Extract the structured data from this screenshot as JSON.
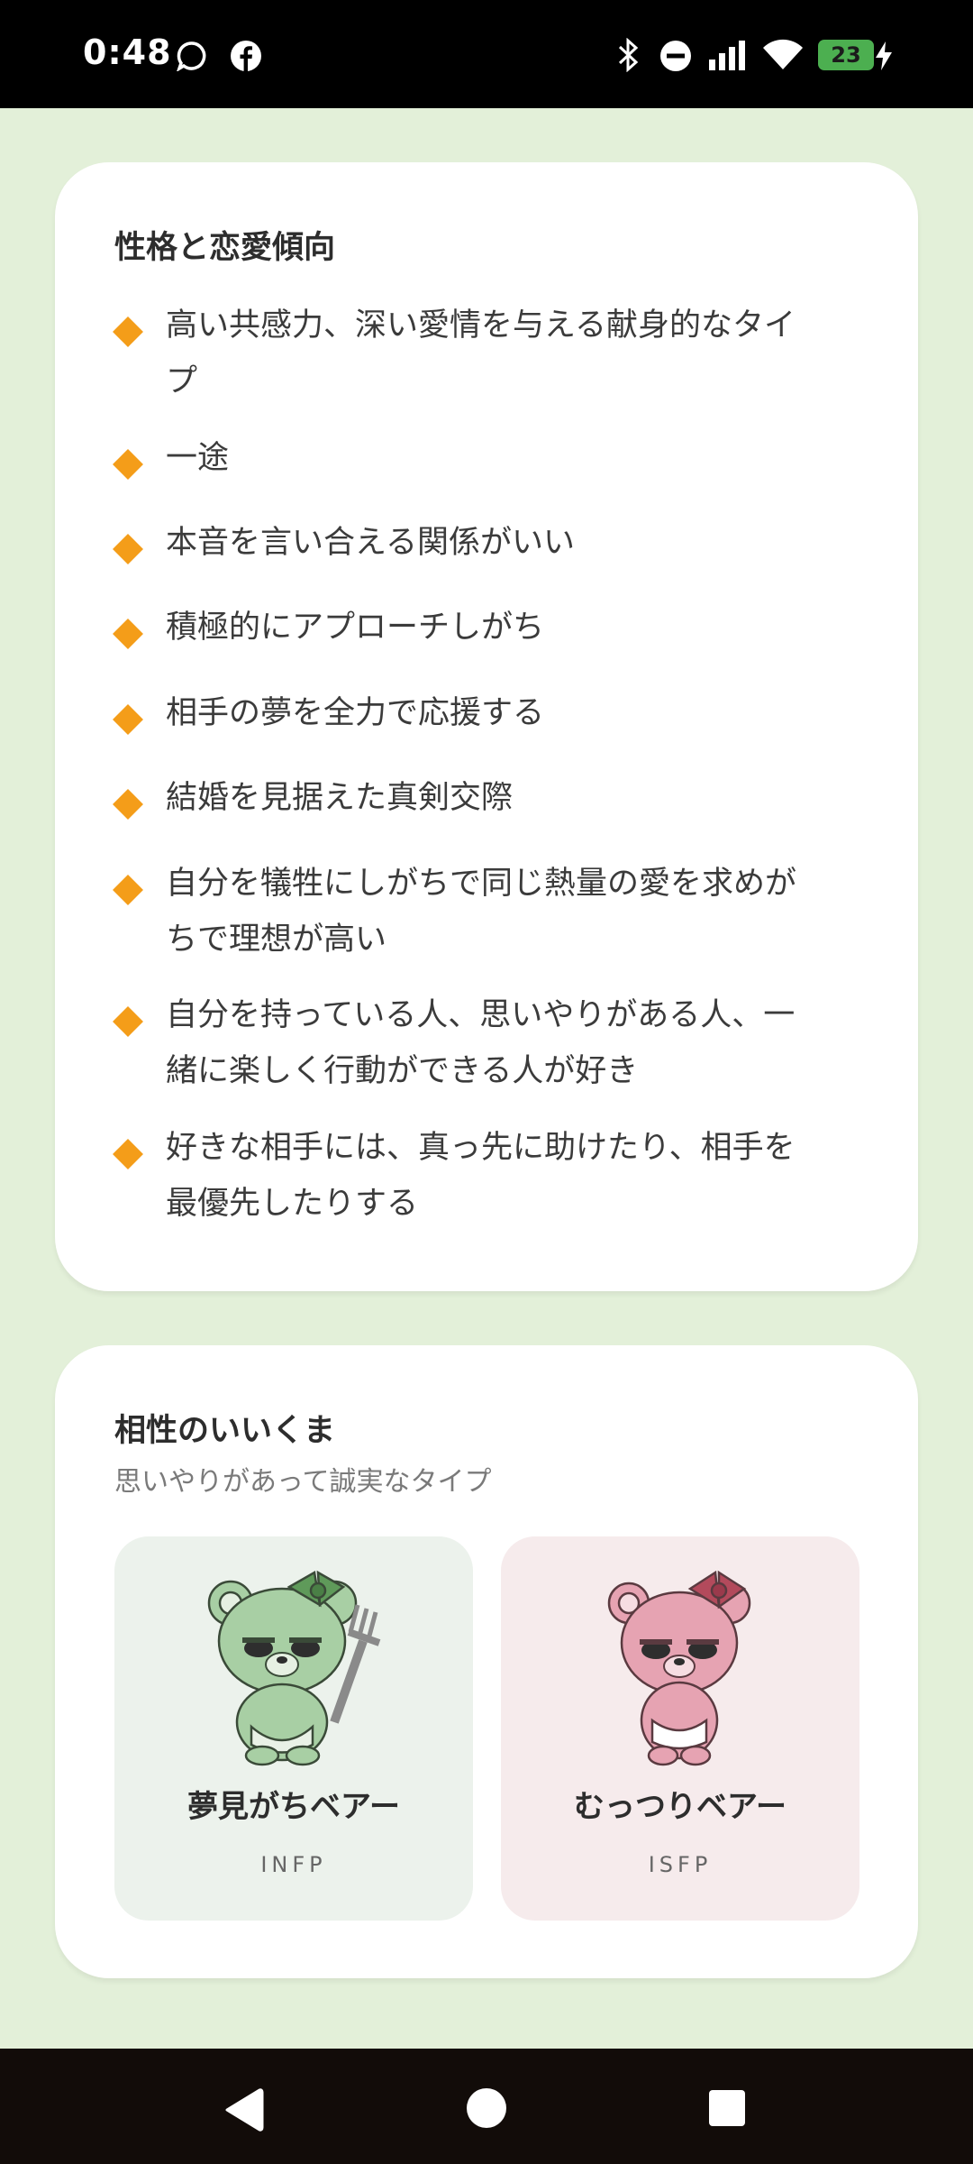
{
  "status_bar": {
    "time": "0:48",
    "battery": "23",
    "icons": [
      "chat-bubble-icon",
      "facebook-icon",
      "bluetooth-icon",
      "do-not-disturb-icon",
      "signal-icon",
      "wifi-icon",
      "battery-icon",
      "charging-icon"
    ]
  },
  "personality": {
    "title": "性格と恋愛傾向",
    "traits": [
      {
        "line1": "高い共感力、深い愛情を与える献身的なタイ",
        "line2": "プ"
      },
      {
        "line1": "一途",
        "line2": ""
      },
      {
        "line1": "本音を言い合える関係がいい",
        "line2": ""
      },
      {
        "line1": "積極的にアプローチしがち",
        "line2": ""
      },
      {
        "line1": "相手の夢を全力で応援する",
        "line2": ""
      },
      {
        "line1": "結婚を見据えた真剣交際",
        "line2": ""
      },
      {
        "line1": "自分を犠牲にしがちで同じ熱量の愛を求めが",
        "line2": "ちで理想が高い"
      },
      {
        "line1": "自分を持っている人、思いやりがある人、一",
        "line2": "緒に楽しく行動ができる人が好き"
      },
      {
        "line1": "好きな相手には、真っ先に助けたり、相手を",
        "line2": "最優先したりする"
      }
    ],
    "bullet_color": "#f49d19"
  },
  "compatibility": {
    "title": "相性のいいくま",
    "subtitle": "思いやりがあって誠実なタイプ",
    "bears": [
      {
        "name": "夢見がちベアー",
        "type": "INFP",
        "color": "#a8cfa4"
      },
      {
        "name": "むっつりベアー",
        "type": "ISFP",
        "color": "#e6a3b2"
      }
    ]
  },
  "nav_bar": {
    "buttons": [
      "back-icon",
      "home-icon",
      "recents-icon"
    ]
  }
}
